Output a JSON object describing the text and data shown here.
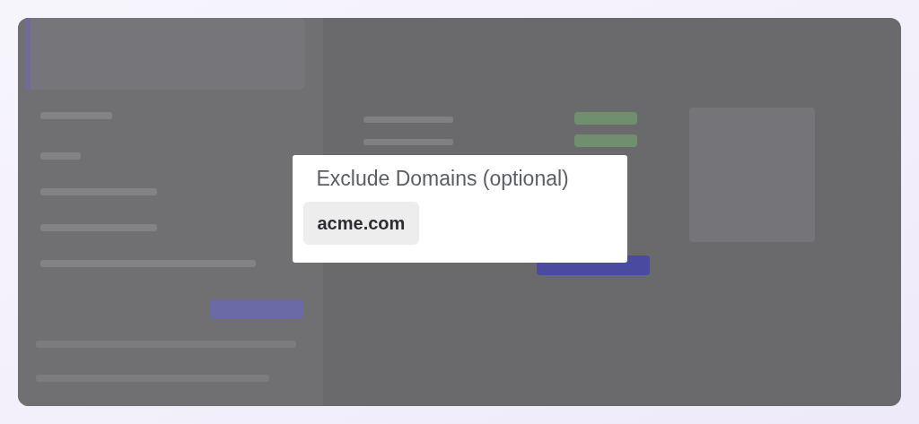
{
  "popup": {
    "title": "Exclude Domains (optional)",
    "chips": [
      "acme.com"
    ]
  }
}
